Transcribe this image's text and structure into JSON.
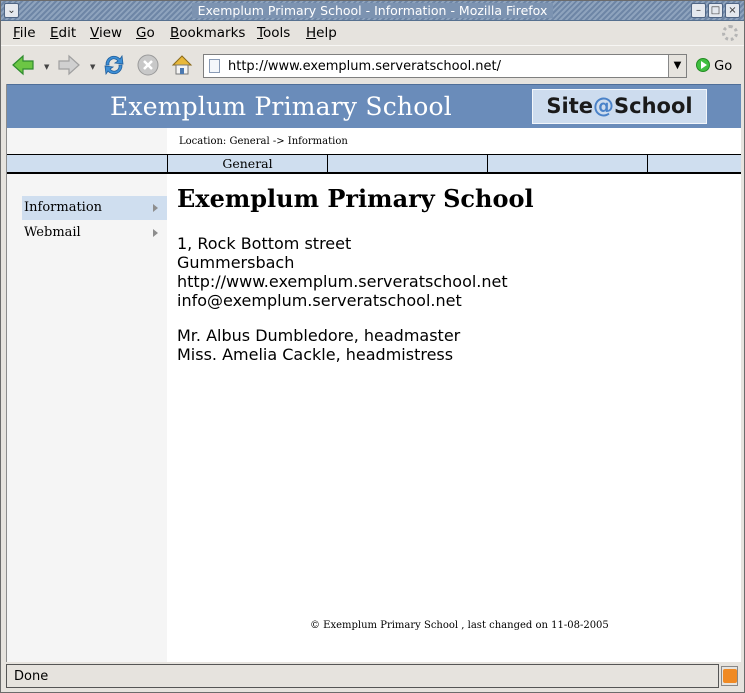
{
  "window": {
    "title": "Exemplum Primary School - Information - Mozilla Firefox"
  },
  "menubar": [
    {
      "label": "File",
      "mnemonic": "F",
      "rest": "ile"
    },
    {
      "label": "Edit",
      "mnemonic": "E",
      "rest": "dit"
    },
    {
      "label": "View",
      "mnemonic": "V",
      "rest": "iew"
    },
    {
      "label": "Go",
      "mnemonic": "G",
      "rest": "o"
    },
    {
      "label": "Bookmarks",
      "mnemonic": "B",
      "rest": "ookmarks"
    },
    {
      "label": "Tools",
      "mnemonic": "T",
      "rest": "ools"
    },
    {
      "label": "Help",
      "mnemonic": "H",
      "rest": "elp"
    }
  ],
  "navbar": {
    "url": "http://www.exemplum.serveratschool.net/",
    "go_label": "Go",
    "icons": [
      "back-icon",
      "forward-icon",
      "reload-icon",
      "stop-icon",
      "home-icon"
    ]
  },
  "page": {
    "site_title": "Exemplum Primary School",
    "logo": {
      "left": "Site",
      "at": "@",
      "right": "School"
    },
    "location": "Location: General -> Information",
    "tabs": [
      "General",
      "",
      "",
      ""
    ],
    "sidebar": [
      {
        "label": "Information",
        "active": true
      },
      {
        "label": "Webmail",
        "active": false
      }
    ],
    "heading": "Exemplum Primary School",
    "address": [
      "1, Rock Bottom street",
      "Gummersbach",
      "http://www.exemplum.serveratschool.net",
      "info@exemplum.serveratschool.net"
    ],
    "staff": [
      "Mr. Albus Dumbledore, headmaster",
      "Miss. Amelia Cackle, headmistress"
    ],
    "footer": "© Exemplum Primary School , last changed on 11-08-2005"
  },
  "statusbar": {
    "text": "Done"
  },
  "colors": {
    "header_band": "#6a8cba",
    "tab_band": "#cfdeef",
    "logo_bg": "#cddcee",
    "logo_at": "#4a82c8"
  }
}
